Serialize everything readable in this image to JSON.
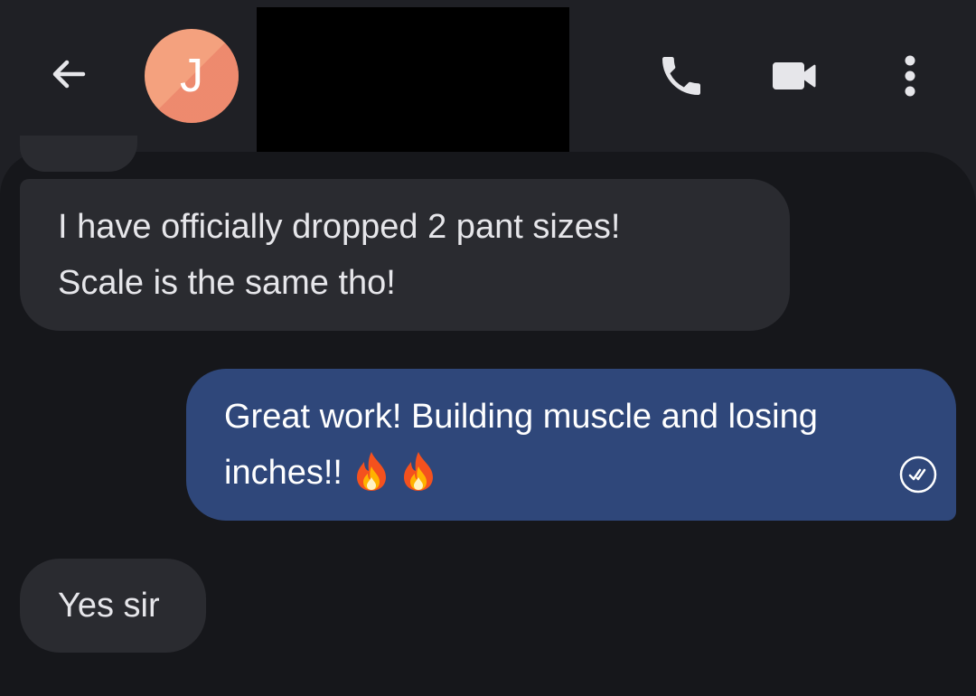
{
  "header": {
    "avatar_letter": "J",
    "avatar_color": "#f4a17e"
  },
  "icons": {
    "back": "arrow-left",
    "call": "phone",
    "video": "video-camera",
    "more": "more-vertical",
    "status": "read-receipt-check",
    "emoji": "fire"
  },
  "colors": {
    "background": "#16171b",
    "appbar": "#1f2025",
    "incoming_bubble": "#2a2b30",
    "outgoing_bubble": "#2f477a"
  },
  "messages": [
    {
      "direction": "incoming",
      "lines": [
        "I have officially dropped 2 pant sizes!",
        "Scale is the same tho!"
      ]
    },
    {
      "direction": "outgoing",
      "lines": [
        "Great work! Building muscle and losing",
        "inches!!"
      ],
      "emojis": [
        "🔥",
        "🔥"
      ],
      "status": "read"
    },
    {
      "direction": "incoming",
      "lines": [
        "Yes sir"
      ]
    }
  ]
}
